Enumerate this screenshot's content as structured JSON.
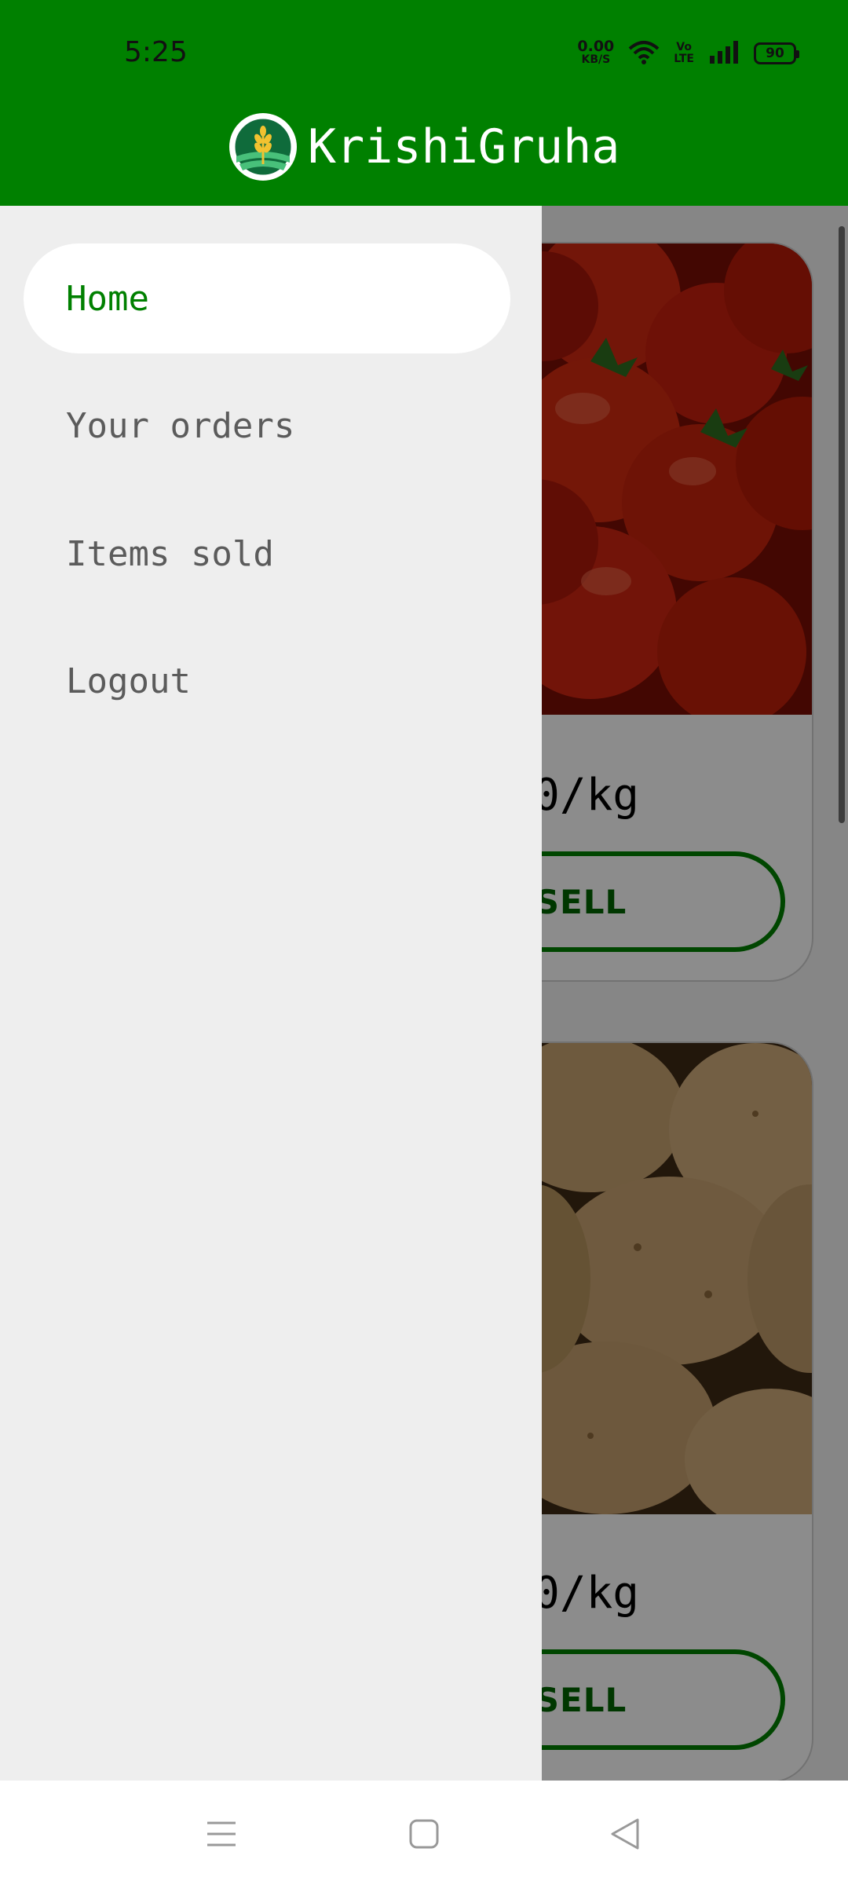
{
  "status_bar": {
    "time": "5:25",
    "net_speed_value": "0.00",
    "net_speed_unit": "KB/S",
    "volte_top": "Vo",
    "volte_bottom": "LTE",
    "battery": "90"
  },
  "app_bar": {
    "title": "KrishiGruha",
    "color": "#008000"
  },
  "drawer": {
    "items": [
      {
        "label": "Home",
        "active": true
      },
      {
        "label": "Your orders",
        "active": false
      },
      {
        "label": "Items sold",
        "active": false
      },
      {
        "label": "Logout",
        "active": false
      }
    ]
  },
  "products": [
    {
      "image": "tomatoes",
      "price_visible": "0/kg",
      "button": "SELL"
    },
    {
      "image": "potatoes",
      "price_visible": "0/kg",
      "button": "SELL"
    }
  ],
  "system_nav": {
    "icons": [
      "menu-icon",
      "home-square-icon",
      "back-triangle-icon"
    ]
  }
}
